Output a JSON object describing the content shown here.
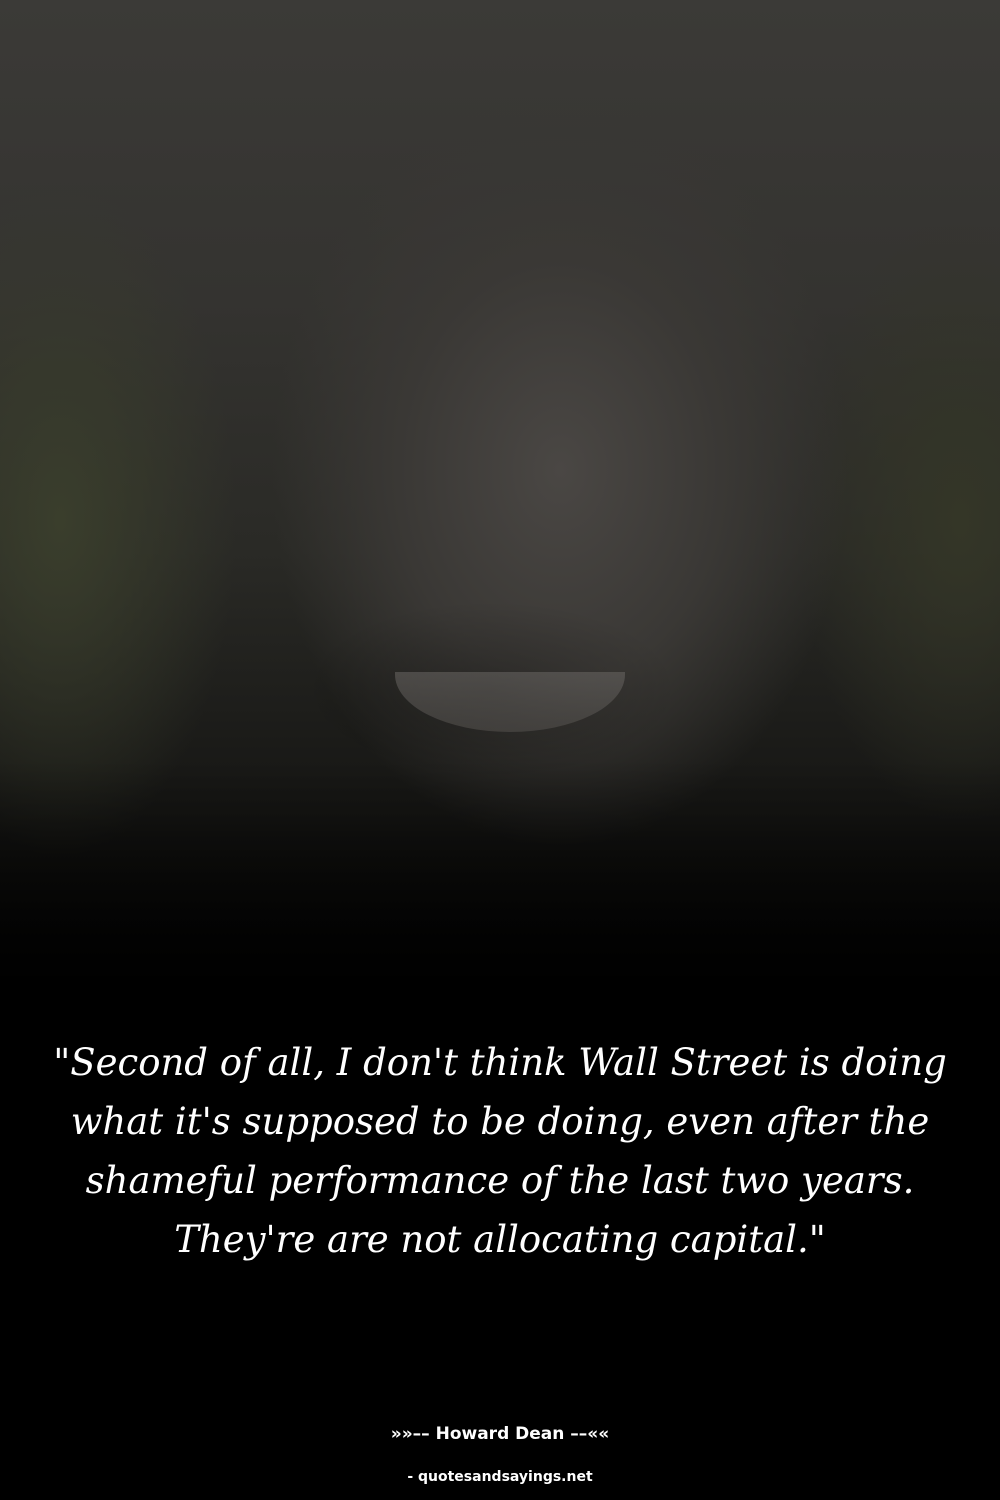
{
  "quote": {
    "text": "\"Second of all, I don't think Wall Street is doing what it's supposed to be doing, even after the shameful performance of the last two years. They're are not allocating capital.\""
  },
  "attribution": {
    "author_line": "»»–– Howard Dean ––««"
  },
  "footer": {
    "source": "- quotesandsayings.net"
  }
}
